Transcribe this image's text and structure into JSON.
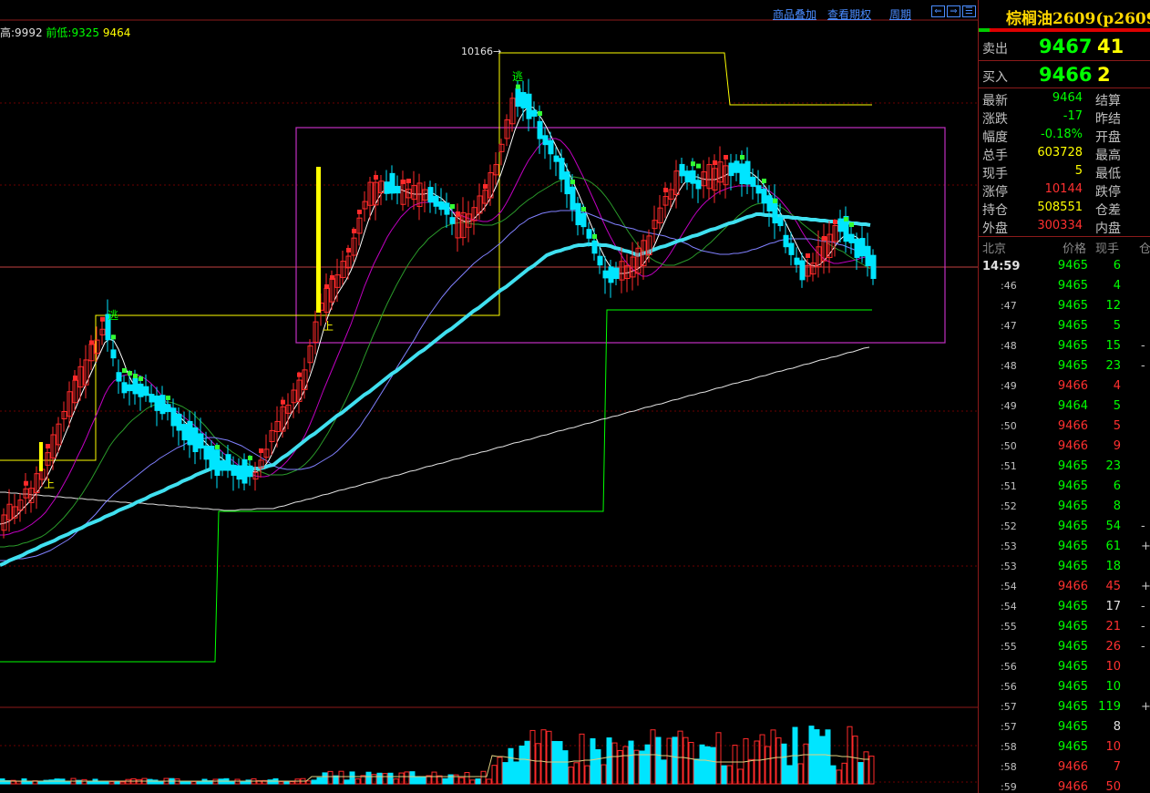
{
  "toolbar": {
    "link1": "商品叠加",
    "link2": "查看期权",
    "link3": "周期",
    "nav_left": "⇐",
    "nav_right": "⇒",
    "nav_menu": "☰"
  },
  "info_line": {
    "high_label": "高:9992",
    "prev_low_label": "前低:9325",
    "last": "9464"
  },
  "chart_labels": {
    "peak": "10166",
    "marker_top": "逃",
    "marker_left": "逃",
    "up_marker_a": "上",
    "up_marker_b": "上"
  },
  "colors": {
    "up": "#ff2a2a",
    "down": "#00e5ff",
    "green": "#00ff00",
    "yellow": "#ffff00",
    "magenta": "#ff00ff",
    "cyan_ma": "#40e0f0",
    "white_ma": "#e0e0e0",
    "grid": "#6b0000",
    "box": "#c030c0"
  },
  "chart_data": {
    "type": "candlestick",
    "title": "",
    "ylim": [
      9100,
      10200
    ],
    "marked_high": 10166,
    "volume_panel": true
  },
  "panel": {
    "symbol": "棕榈油2609(p2609",
    "sell_label": "卖出",
    "sell_price": "9467",
    "sell_vol": "41",
    "buy_label": "买入",
    "buy_price": "9466",
    "buy_vol": "2",
    "stats": [
      {
        "l": "最新",
        "v": "9464",
        "r": "结算",
        "c": "#00ff00"
      },
      {
        "l": "涨跌",
        "v": "-17",
        "r": "昨结",
        "c": "#00ff00"
      },
      {
        "l": "幅度",
        "v": "-0.18%",
        "r": "开盘",
        "c": "#00ff00"
      },
      {
        "l": "总手",
        "v": "603728",
        "r": "最高",
        "c": "#ffff00"
      },
      {
        "l": "现手",
        "v": "5",
        "r": "最低",
        "c": "#ffff00"
      },
      {
        "l": "涨停",
        "v": "10144",
        "r": "跌停",
        "c": "#ff3030"
      },
      {
        "l": "持仓",
        "v": "508551",
        "r": "仓差",
        "c": "#ffff00"
      },
      {
        "l": "外盘",
        "v": "300334",
        "r": "内盘",
        "c": "#ff3030"
      }
    ],
    "ticks_header": {
      "time": "北京",
      "price": "价格",
      "vol": "现手",
      "pos": "仓"
    },
    "ticks": [
      {
        "t": "14:59",
        "p": "9465",
        "v": "6",
        "pc": "#00ff00",
        "vc": "#00ff00",
        "f": ""
      },
      {
        "t": ":46",
        "p": "9465",
        "v": "4",
        "pc": "#00ff00",
        "vc": "#00ff00",
        "f": ""
      },
      {
        "t": ":47",
        "p": "9465",
        "v": "12",
        "pc": "#00ff00",
        "vc": "#00ff00",
        "f": ""
      },
      {
        "t": ":47",
        "p": "9465",
        "v": "5",
        "pc": "#00ff00",
        "vc": "#00ff00",
        "f": ""
      },
      {
        "t": ":48",
        "p": "9465",
        "v": "15",
        "pc": "#00ff00",
        "vc": "#00ff00",
        "f": "-"
      },
      {
        "t": ":48",
        "p": "9465",
        "v": "23",
        "pc": "#00ff00",
        "vc": "#00ff00",
        "f": "-"
      },
      {
        "t": ":49",
        "p": "9466",
        "v": "4",
        "pc": "#ff3030",
        "vc": "#ff3030",
        "f": ""
      },
      {
        "t": ":49",
        "p": "9464",
        "v": "5",
        "pc": "#00ff00",
        "vc": "#00ff00",
        "f": ""
      },
      {
        "t": ":50",
        "p": "9466",
        "v": "5",
        "pc": "#ff3030",
        "vc": "#ff3030",
        "f": ""
      },
      {
        "t": ":50",
        "p": "9466",
        "v": "9",
        "pc": "#ff3030",
        "vc": "#ff3030",
        "f": ""
      },
      {
        "t": ":51",
        "p": "9465",
        "v": "23",
        "pc": "#00ff00",
        "vc": "#00ff00",
        "f": ""
      },
      {
        "t": ":51",
        "p": "9465",
        "v": "6",
        "pc": "#00ff00",
        "vc": "#00ff00",
        "f": ""
      },
      {
        "t": ":52",
        "p": "9465",
        "v": "8",
        "pc": "#00ff00",
        "vc": "#00ff00",
        "f": ""
      },
      {
        "t": ":52",
        "p": "9465",
        "v": "54",
        "pc": "#00ff00",
        "vc": "#00ff00",
        "f": "-"
      },
      {
        "t": ":53",
        "p": "9465",
        "v": "61",
        "pc": "#00ff00",
        "vc": "#00ff00",
        "f": "+"
      },
      {
        "t": ":53",
        "p": "9465",
        "v": "18",
        "pc": "#00ff00",
        "vc": "#00ff00",
        "f": ""
      },
      {
        "t": ":54",
        "p": "9466",
        "v": "45",
        "pc": "#ff3030",
        "vc": "#ff3030",
        "f": "+"
      },
      {
        "t": ":54",
        "p": "9465",
        "v": "17",
        "pc": "#00ff00",
        "vc": "#e0e0e0",
        "f": "-"
      },
      {
        "t": ":55",
        "p": "9465",
        "v": "21",
        "pc": "#00ff00",
        "vc": "#ff3030",
        "f": "-"
      },
      {
        "t": ":55",
        "p": "9465",
        "v": "26",
        "pc": "#00ff00",
        "vc": "#ff3030",
        "f": "-"
      },
      {
        "t": ":56",
        "p": "9465",
        "v": "10",
        "pc": "#00ff00",
        "vc": "#ff3030",
        "f": ""
      },
      {
        "t": ":56",
        "p": "9465",
        "v": "10",
        "pc": "#00ff00",
        "vc": "#00ff00",
        "f": ""
      },
      {
        "t": ":57",
        "p": "9465",
        "v": "119",
        "pc": "#00ff00",
        "vc": "#00ff00",
        "f": "+"
      },
      {
        "t": ":57",
        "p": "9465",
        "v": "8",
        "pc": "#00ff00",
        "vc": "#e0e0e0",
        "f": ""
      },
      {
        "t": ":58",
        "p": "9465",
        "v": "10",
        "pc": "#00ff00",
        "vc": "#ff3030",
        "f": ""
      },
      {
        "t": ":58",
        "p": "9466",
        "v": "7",
        "pc": "#ff3030",
        "vc": "#ff3030",
        "f": ""
      },
      {
        "t": ":59",
        "p": "9466",
        "v": "50",
        "pc": "#ff3030",
        "vc": "#ff3030",
        "f": ""
      }
    ]
  }
}
